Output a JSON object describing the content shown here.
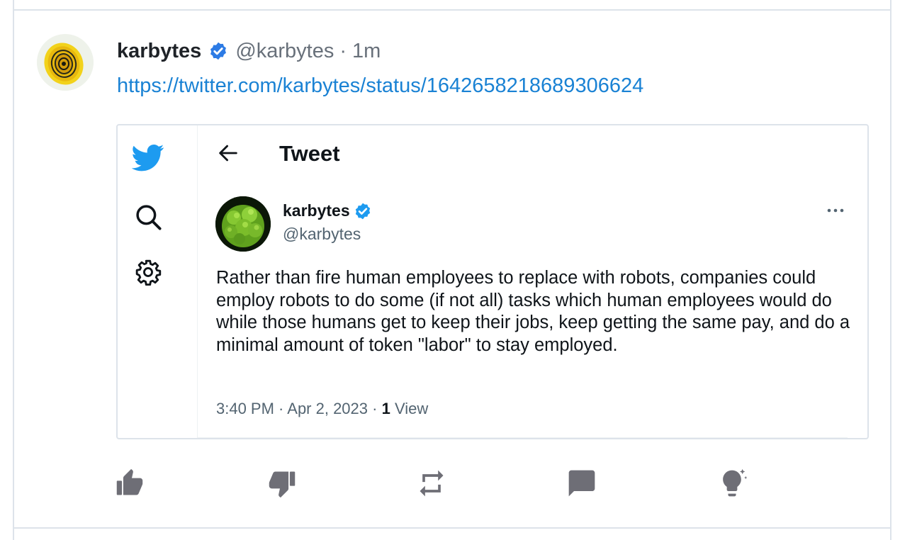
{
  "post": {
    "author_name": "karbytes",
    "author_handle": "@karbytes",
    "separator": "·",
    "relative_time": "1m",
    "link_text": "https://twitter.com/karbytes/status/1642658218689306624"
  },
  "embed": {
    "page_title": "Tweet",
    "tweet": {
      "author_name": "karbytes",
      "author_handle": "@karbytes",
      "body": "Rather than fire human employees to replace with robots, companies could employ robots to do some (if not all) tasks which human employees would do while those humans get to keep their jobs, keep getting the same pay, and do a minimal amount of token \"labor\" to stay employed.",
      "timestamp": "3:40 PM · Apr 2, 2023 · ",
      "views_count": "1",
      "views_label": " View"
    },
    "sidebar_icons": [
      "twitter-bird-icon",
      "search-icon",
      "settings-gear-icon"
    ]
  },
  "actions": [
    "thumbs-up-icon",
    "thumbs-down-icon",
    "repost-icon",
    "comment-icon",
    "lightbulb-icon"
  ],
  "colors": {
    "accent_link": "#1a82d4",
    "twitter_blue": "#1d9bf0",
    "verified_blue": "#2c7be5",
    "action_icon": "#6e6e76",
    "border": "#dde3ea"
  }
}
